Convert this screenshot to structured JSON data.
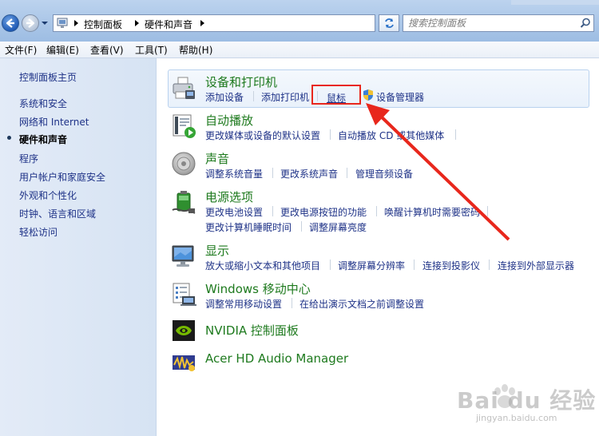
{
  "address": {
    "crumbs": [
      "控制面板",
      "硬件和声音"
    ]
  },
  "search": {
    "placeholder": "搜索控制面板"
  },
  "menu": [
    "文件(F)",
    "编辑(E)",
    "查看(V)",
    "工具(T)",
    "帮助(H)"
  ],
  "sidebar": {
    "home": "控制面板主页",
    "items": [
      {
        "label": "系统和安全",
        "current": false
      },
      {
        "label": "网络和 Internet",
        "current": false
      },
      {
        "label": "硬件和声音",
        "current": true
      },
      {
        "label": "程序",
        "current": false
      },
      {
        "label": "用户帐户和家庭安全",
        "current": false
      },
      {
        "label": "外观和个性化",
        "current": false
      },
      {
        "label": "时钟、语言和区域",
        "current": false
      },
      {
        "label": "轻松访问",
        "current": false
      }
    ]
  },
  "categories": {
    "devices": {
      "title": "设备和打印机",
      "icon": "printer-icon",
      "links": [
        "添加设备",
        "添加打印机",
        "鼠标",
        "设备管理器"
      ]
    },
    "autoplay": {
      "title": "自动播放",
      "icon": "autoplay-icon",
      "links": [
        "更改媒体或设备的默认设置",
        "自动播放 CD 或其他媒体"
      ]
    },
    "sound": {
      "title": "声音",
      "icon": "speaker-icon",
      "links": [
        "调整系统音量",
        "更改系统声音",
        "管理音频设备"
      ]
    },
    "power": {
      "title": "电源选项",
      "icon": "battery-icon",
      "links": [
        "更改电池设置",
        "更改电源按钮的功能",
        "唤醒计算机时需要密码",
        "更改计算机睡眠时间",
        "调整屏幕亮度"
      ]
    },
    "display": {
      "title": "显示",
      "icon": "monitor-icon",
      "links": [
        "放大或缩小文本和其他项目",
        "调整屏幕分辨率",
        "连接到投影仪",
        "连接到外部显示器"
      ]
    },
    "mobility": {
      "title": "Windows 移动中心",
      "icon": "mobility-center-icon",
      "links": [
        "调整常用移动设置",
        "在给出演示文档之前调整设置"
      ]
    },
    "nvidia": {
      "title": "NVIDIA 控制面板",
      "icon": "nvidia-icon"
    },
    "acer": {
      "title": "Acer HD Audio Manager",
      "icon": "acer-audio-icon"
    }
  },
  "watermark": {
    "text": "Bai du 经验",
    "url": "jingyan.baidu.com"
  },
  "colors": {
    "link": "#1e3287",
    "category_title": "#1e7a1e",
    "annotation": "#e8271c"
  }
}
